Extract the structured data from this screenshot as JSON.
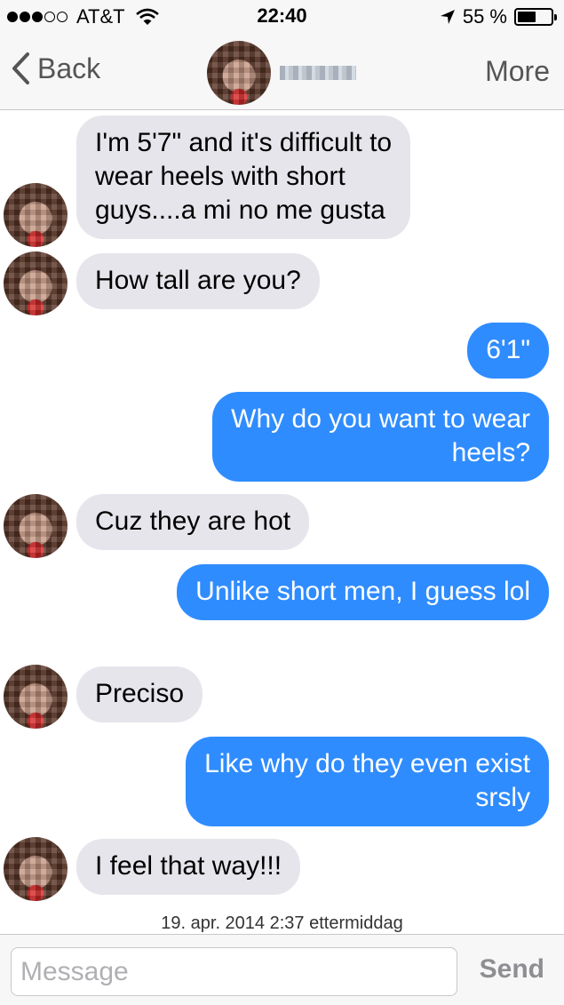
{
  "status_bar": {
    "signal_bars_filled": 3,
    "signal_bars_total": 5,
    "carrier": "AT&T",
    "time": "22:40",
    "battery_percent_label": "55 %",
    "battery_level": 0.55
  },
  "nav": {
    "back_label": "Back",
    "more_label": "More",
    "contact_avatar_icon": "pixelated-avatar-icon"
  },
  "messages": [
    {
      "direction": "incoming",
      "lines": [
        "I'm 5'7\" and it's difficult to",
        "wear heels with short",
        "guys....a mi no me gusta"
      ]
    },
    {
      "direction": "incoming",
      "lines": [
        "How tall are you?"
      ]
    },
    {
      "direction": "outgoing",
      "lines": [
        "6'1\""
      ]
    },
    {
      "direction": "outgoing",
      "lines": [
        "Why do you want to wear",
        "heels?"
      ]
    },
    {
      "direction": "incoming",
      "lines": [
        "Cuz they are hot"
      ]
    },
    {
      "direction": "outgoing",
      "lines": [
        "Unlike short men, I guess lol"
      ]
    },
    {
      "direction": "incoming",
      "lines": [
        "Preciso"
      ]
    },
    {
      "direction": "outgoing",
      "lines": [
        "Like why do they even exist",
        "srsly"
      ]
    },
    {
      "direction": "incoming",
      "lines": [
        "I feel that way!!!"
      ]
    }
  ],
  "timestamp": "19. apr. 2014 2:37 ettermiddag",
  "composer": {
    "placeholder": "Message",
    "value": "",
    "send_label": "Send"
  },
  "colors": {
    "incoming_bubble": "#e6e5eb",
    "outgoing_bubble": "#2f8cff",
    "bar_background": "#f7f7f8"
  }
}
